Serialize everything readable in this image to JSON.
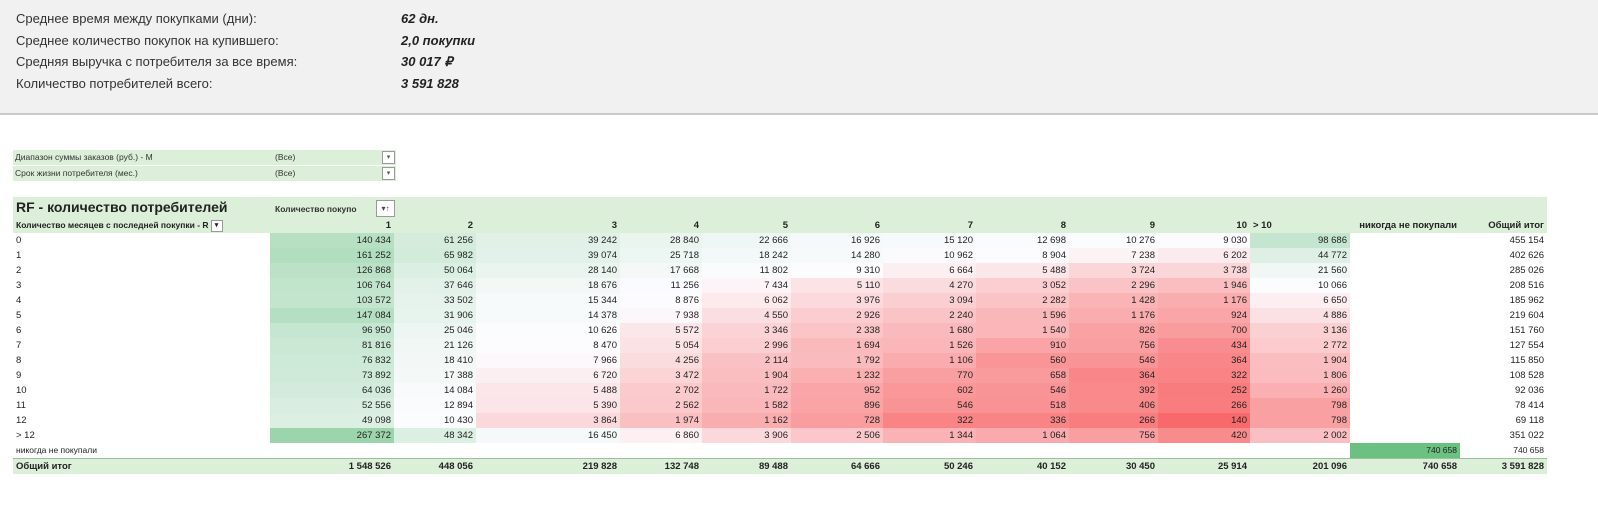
{
  "summary": [
    {
      "label": "Среднее время между покупками (дни):",
      "value": "62 дн."
    },
    {
      "label": "Среднее количество покупок на купившего:",
      "value": "2,0 покупки"
    },
    {
      "label": "Средняя выручка с потребителя за все время:",
      "value": "30 017 ₽"
    },
    {
      "label": "Количество потребителей всего:",
      "value": "3 591 828"
    }
  ],
  "filters": [
    {
      "label": "Диапазон суммы заказов (руб.) - M",
      "value": "(Все)"
    },
    {
      "label": "Срок жизни потребителя (мес.)",
      "value": "(Все)"
    }
  ],
  "pivot": {
    "title": "RF - количество потребителей",
    "column_field": "Количество покупо",
    "row_field": "Количество месяцев с последней покупки - R",
    "columns": [
      "1",
      "2",
      "3",
      "4",
      "5",
      "6",
      "7",
      "8",
      "9",
      "10",
      "> 10",
      "никогда не покупали",
      "Общий итог"
    ],
    "rows": [
      {
        "label": "0",
        "values": [
          "140 434",
          "61 256",
          "39 242",
          "28 840",
          "22 666",
          "16 926",
          "15 120",
          "12 698",
          "10 276",
          "9 030",
          "98 686",
          "",
          "455 154"
        ]
      },
      {
        "label": "1",
        "values": [
          "161 252",
          "65 982",
          "39 074",
          "25 718",
          "18 242",
          "14 280",
          "10 962",
          "8 904",
          "7 238",
          "6 202",
          "44 772",
          "",
          "402 626"
        ]
      },
      {
        "label": "2",
        "values": [
          "126 868",
          "50 064",
          "28 140",
          "17 668",
          "11 802",
          "9 310",
          "6 664",
          "5 488",
          "3 724",
          "3 738",
          "21 560",
          "",
          "285 026"
        ]
      },
      {
        "label": "3",
        "values": [
          "106 764",
          "37 646",
          "18 676",
          "11 256",
          "7 434",
          "5 110",
          "4 270",
          "3 052",
          "2 296",
          "1 946",
          "10 066",
          "",
          "208 516"
        ]
      },
      {
        "label": "4",
        "values": [
          "103 572",
          "33 502",
          "15 344",
          "8 876",
          "6 062",
          "3 976",
          "3 094",
          "2 282",
          "1 428",
          "1 176",
          "6 650",
          "",
          "185 962"
        ]
      },
      {
        "label": "5",
        "values": [
          "147 084",
          "31 906",
          "14 378",
          "7 938",
          "4 550",
          "2 926",
          "2 240",
          "1 596",
          "1 176",
          "924",
          "4 886",
          "",
          "219 604"
        ]
      },
      {
        "label": "6",
        "values": [
          "96 950",
          "25 046",
          "10 626",
          "5 572",
          "3 346",
          "2 338",
          "1 680",
          "1 540",
          "826",
          "700",
          "3 136",
          "",
          "151 760"
        ]
      },
      {
        "label": "7",
        "values": [
          "81 816",
          "21 126",
          "8 470",
          "5 054",
          "2 996",
          "1 694",
          "1 526",
          "910",
          "756",
          "434",
          "2 772",
          "",
          "127 554"
        ]
      },
      {
        "label": "8",
        "values": [
          "76 832",
          "18 410",
          "7 966",
          "4 256",
          "2 114",
          "1 792",
          "1 106",
          "560",
          "546",
          "364",
          "1 904",
          "",
          "115 850"
        ]
      },
      {
        "label": "9",
        "values": [
          "73 892",
          "17 388",
          "6 720",
          "3 472",
          "1 904",
          "1 232",
          "770",
          "658",
          "364",
          "322",
          "1 806",
          "",
          "108 528"
        ]
      },
      {
        "label": "10",
        "values": [
          "64 036",
          "14 084",
          "5 488",
          "2 702",
          "1 722",
          "952",
          "602",
          "546",
          "392",
          "252",
          "1 260",
          "",
          "92 036"
        ]
      },
      {
        "label": "11",
        "values": [
          "52 556",
          "12 894",
          "5 390",
          "2 562",
          "1 582",
          "896",
          "546",
          "518",
          "406",
          "266",
          "798",
          "",
          "78 414"
        ]
      },
      {
        "label": "12",
        "values": [
          "49 098",
          "10 430",
          "3 864",
          "1 974",
          "1 162",
          "728",
          "322",
          "336",
          "266",
          "140",
          "798",
          "",
          "69 118"
        ]
      },
      {
        "label": "> 12",
        "values": [
          "267 372",
          "48 342",
          "16 450",
          "6 860",
          "3 906",
          "2 506",
          "1 344",
          "1 064",
          "756",
          "420",
          "2 002",
          "",
          "351 022"
        ]
      },
      {
        "label": "никогда не покупали",
        "values": [
          "",
          "",
          "",
          "",
          "",
          "",
          "",
          "",
          "",
          "",
          "",
          "740 658",
          "740 658"
        ]
      }
    ],
    "total": {
      "label": "Общий итог",
      "values": [
        "1 548 526",
        "448 056",
        "219 828",
        "132 748",
        "89 488",
        "64 666",
        "50 246",
        "40 152",
        "30 450",
        "25 914",
        "201 096",
        "740 658",
        "3 591 828"
      ]
    }
  },
  "colors": {
    "header_green": "#dcefd9",
    "high_green": "#63be7b",
    "low_red": "#f8696b",
    "neutral": "#fcfcff",
    "summary_bg": "#f1f1f1"
  }
}
